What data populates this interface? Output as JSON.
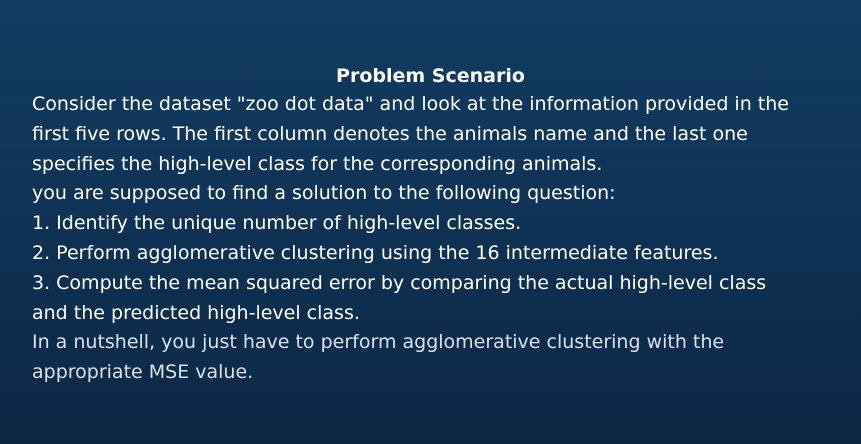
{
  "title": "Problem Scenario",
  "lines": [
    "Consider the dataset \"zoo dot data\" and look at the information provided in the",
    "first five rows. The first column denotes the animals name and the last one",
    "specifies the high-level class for the corresponding animals.",
    "you are supposed to find a solution to the following question:",
    "1. Identify the unique number of high-level classes.",
    "2. Perform agglomerative clustering using the 16 intermediate features.",
    "3. Compute the mean squared error by comparing the actual high-level class",
    "and the predicted high-level class.",
    "In a nutshell, you just have to perform agglomerative clustering with the",
    "appropriate MSE value."
  ]
}
